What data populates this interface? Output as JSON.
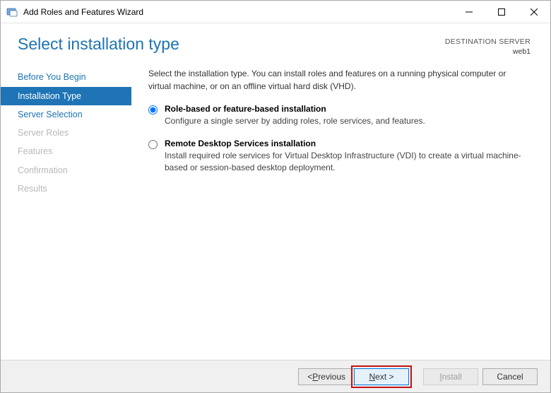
{
  "titlebar": {
    "title": "Add Roles and Features Wizard"
  },
  "header": {
    "heading": "Select installation type",
    "destination_label": "DESTINATION SERVER",
    "destination_name": "web1"
  },
  "sidebar": {
    "items": [
      {
        "label": "Before You Begin",
        "state": "normal"
      },
      {
        "label": "Installation Type",
        "state": "active"
      },
      {
        "label": "Server Selection",
        "state": "normal"
      },
      {
        "label": "Server Roles",
        "state": "disabled"
      },
      {
        "label": "Features",
        "state": "disabled"
      },
      {
        "label": "Confirmation",
        "state": "disabled"
      },
      {
        "label": "Results",
        "state": "disabled"
      }
    ]
  },
  "content": {
    "intro": "Select the installation type. You can install roles and features on a running physical computer or virtual machine, or on an offline virtual hard disk (VHD).",
    "options": [
      {
        "title": "Role-based or feature-based installation",
        "desc": "Configure a single server by adding roles, role services, and features.",
        "selected": true
      },
      {
        "title": "Remote Desktop Services installation",
        "desc": "Install required role services for Virtual Desktop Infrastructure (VDI) to create a virtual machine-based or session-based desktop deployment.",
        "selected": false
      }
    ]
  },
  "footer": {
    "previous_prefix": "< ",
    "previous_letter": "P",
    "previous_rest": "revious",
    "next_letter": "N",
    "next_rest": "ext >",
    "install_letter": "I",
    "install_rest": "nstall",
    "cancel": "Cancel"
  }
}
